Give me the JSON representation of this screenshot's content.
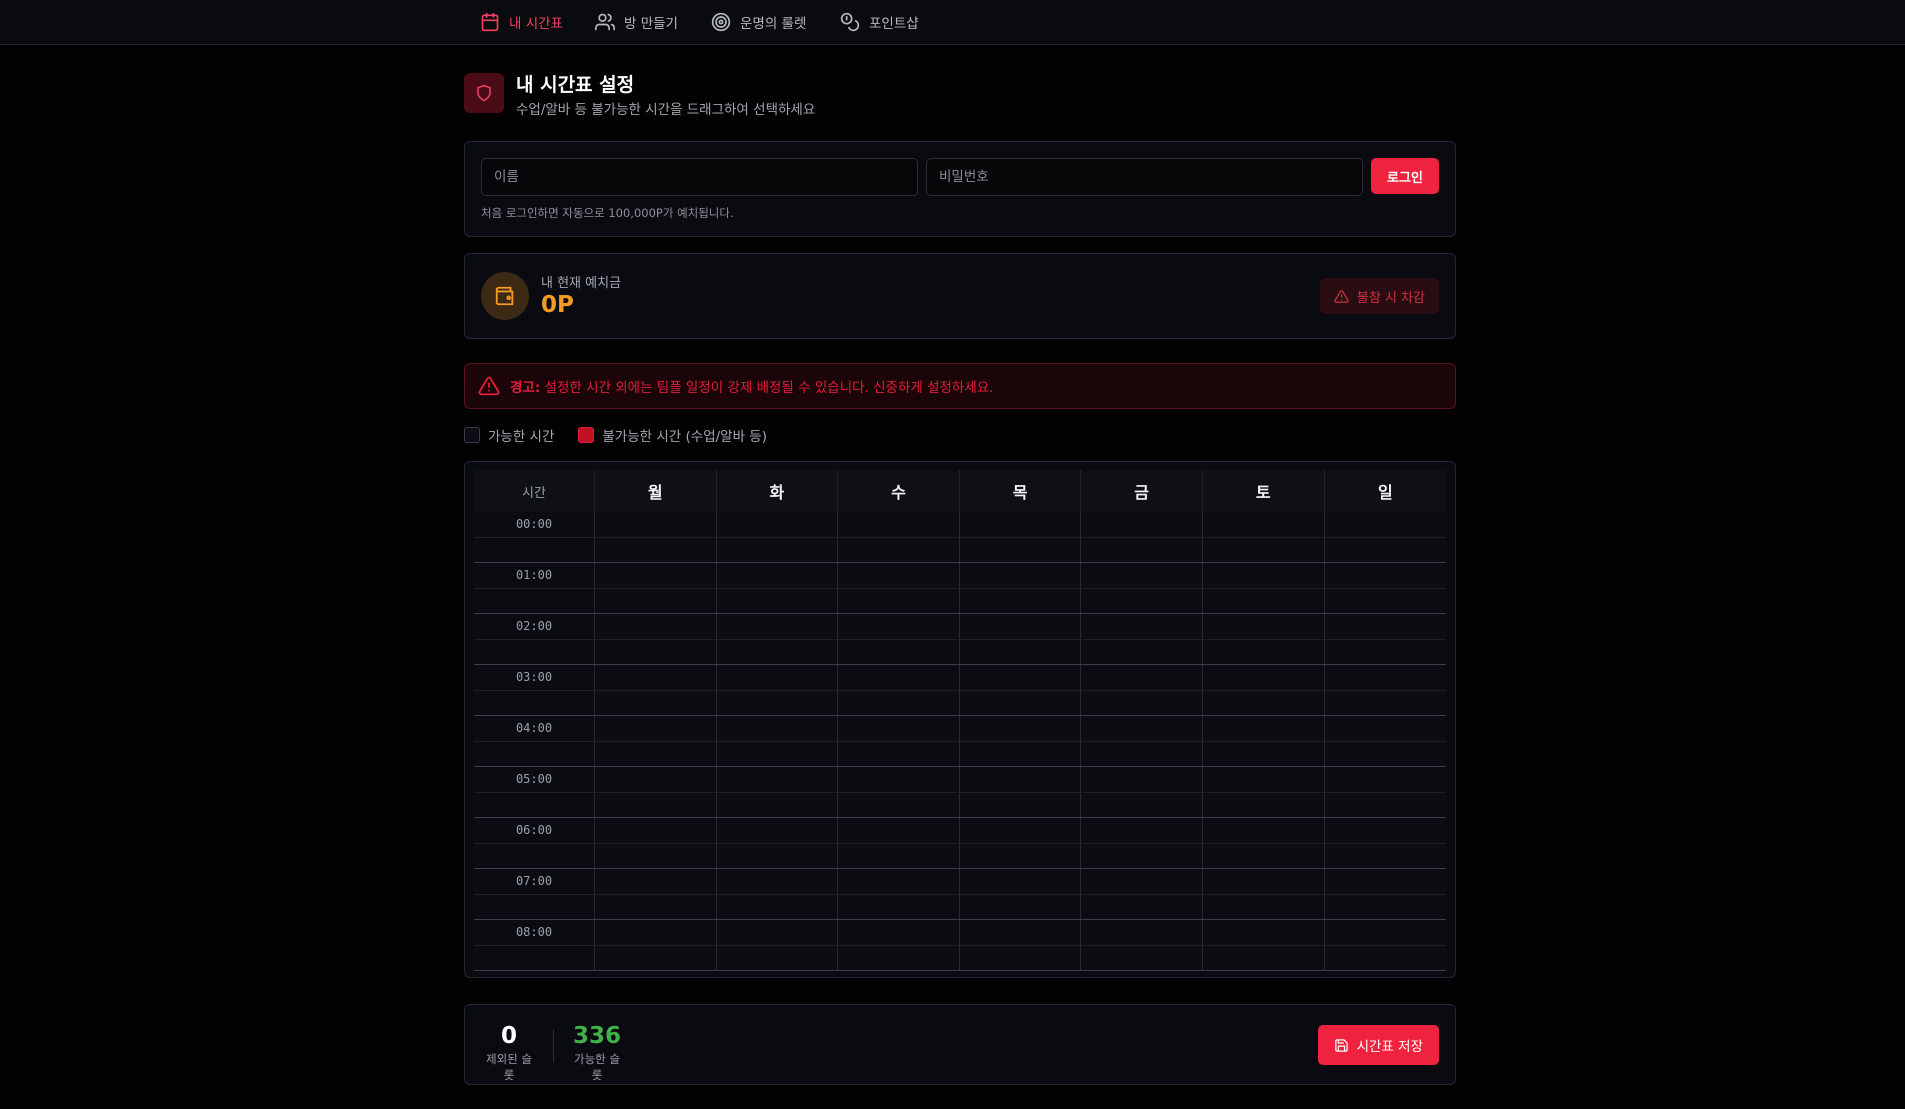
{
  "nav": {
    "items": [
      {
        "label": "내 시간표",
        "icon": "calendar-icon",
        "active": true
      },
      {
        "label": "방 만들기",
        "icon": "users-icon",
        "active": false
      },
      {
        "label": "운명의 룰렛",
        "icon": "target-icon",
        "active": false
      },
      {
        "label": "포인트샵",
        "icon": "coins-icon",
        "active": false
      }
    ]
  },
  "header": {
    "title": "내 시간표 설정",
    "subtitle": "수업/알바 등 불가능한 시간을 드래그하여 선택하세요"
  },
  "login": {
    "name_placeholder": "이름",
    "password_placeholder": "비밀번호",
    "button_label": "로그인",
    "note": "처음 로그인하면 자동으로 100,000P가 예치됩니다."
  },
  "deposit": {
    "label": "내 현재 예치금",
    "value": "0P",
    "penalty_label": "불참 시 차감"
  },
  "warning": {
    "prefix": "경고:",
    "text": " 설정한 시간 외에는 팀플 일정이 강제 배정될 수 있습니다. 신중하게 설정하세요."
  },
  "legend": {
    "available": "가능한 시간",
    "unavailable": "불가능한 시간 (수업/알바 등)"
  },
  "grid": {
    "time_header": "시간",
    "days": [
      "월",
      "화",
      "수",
      "목",
      "금",
      "토",
      "일"
    ],
    "hours": [
      "00:00",
      "01:00",
      "02:00",
      "03:00",
      "04:00",
      "05:00",
      "06:00",
      "07:00",
      "08:00"
    ]
  },
  "stats": {
    "excluded_value": "0",
    "excluded_label": "제외된 슬롯",
    "available_value": "336",
    "available_label": "가능한 슬롯",
    "save_label": "시간표 저장"
  },
  "colors": {
    "accent": "#f0233f",
    "deposit": "#f59a23",
    "available_count": "#3fb24a"
  }
}
